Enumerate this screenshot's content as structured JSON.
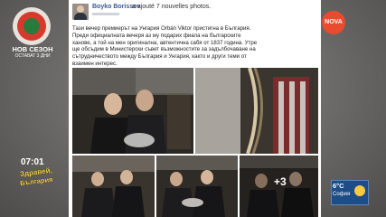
{
  "show": {
    "title": "НОВ СЕЗОН",
    "subtitle": "ОСТАВАТ 3 ДНИ"
  },
  "channel": {
    "logo_text": "NOVA"
  },
  "post": {
    "author": "Boyko Borissov",
    "action": "a ajouté 7 nouvelles photos.",
    "text_lines": [
      "Тази вечер премиерът на Унгария Orbán Viktor пристигна в България.",
      "Преди официалната вечеря аз му подарих фиала на българските",
      "ханове, а той на мен оригинална, автентична сабя от 1837 година. Утре",
      "ще обсъдим в Министерски съвет възможностите за задълбочаване на",
      "сътрудничеството между България и Унгария, както и други теми от",
      "взаимен интерес."
    ],
    "more_photos": "+3"
  },
  "bottom": {
    "time": "07:01",
    "brand_line1": "Здравей,",
    "brand_line2": "България"
  },
  "weather": {
    "temp": "6°C",
    "city": "София"
  },
  "icons": {
    "channel": "nova-logo-icon",
    "weather": "sun-icon",
    "show": "show-logo-icon"
  },
  "colors": {
    "facebook_link": "#3b5998",
    "nova_orange": "#e94b2f",
    "brand_yellow": "#f4d24a",
    "weather_blue": "#1c4d86"
  }
}
